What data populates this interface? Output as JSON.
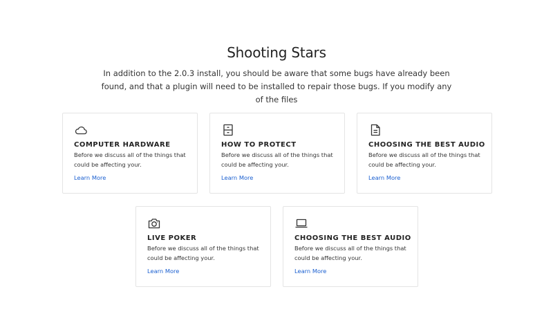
{
  "header": {
    "title": "Shooting Stars",
    "subtitle": "In addition to the 2.0.3 install, you should be aware that some bugs have already been found, and that a plugin will need to be installed to repair those bugs. If you modify any of the files"
  },
  "cards": [
    {
      "icon": "cloud-icon",
      "title": "COMPUTER HARDWARE",
      "description": "Before we discuss all of the things that could be affecting your.",
      "link": "Learn More"
    },
    {
      "icon": "cabinet-icon",
      "title": "HOW TO PROTECT",
      "description": "Before we discuss all of the things that could be affecting your.",
      "link": "Learn More"
    },
    {
      "icon": "document-icon",
      "title": "CHOOSING THE BEST AUDIO",
      "description": "Before we discuss all of the things that could be affecting your.",
      "link": "Learn More"
    },
    {
      "icon": "camera-icon",
      "title": "LIVE POKER",
      "description": "Before we discuss all of the things that could be affecting your.",
      "link": "Learn More"
    },
    {
      "icon": "laptop-icon",
      "title": "CHOOSING THE BEST AUDIO",
      "description": "Before we discuss all of the things that could be affecting your.",
      "link": "Learn More"
    }
  ],
  "colors": {
    "link": "#1a5fd0",
    "border": "#e4e4e4",
    "text": "#222222"
  }
}
